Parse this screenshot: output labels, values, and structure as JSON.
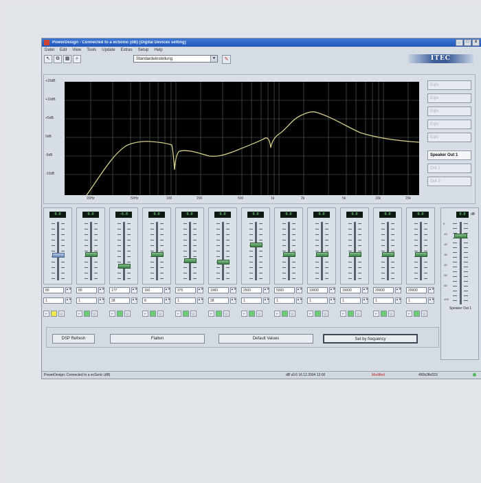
{
  "window": {
    "title": "PowerDesign - Connected to a ecSonic (dB) [Digital Devices setting]",
    "controls": [
      "_",
      "□",
      "x"
    ]
  },
  "menu": [
    "Datei",
    "Edit",
    "View",
    "Tools",
    "Update",
    "Extras",
    "Setup",
    "Help"
  ],
  "toolbar": {
    "buttons": [
      "arrow-icon",
      "copy-icon",
      "grid-icon",
      "zoom-icon"
    ],
    "preset_value": "Standardeinstellung",
    "logo": "ITEC"
  },
  "graph": {
    "y_labels": [
      "+15dB",
      "+10dB",
      "+5dB",
      "0dB",
      "-5dB",
      "-10dB"
    ],
    "x_labels": [
      "20Hz",
      "50Hz",
      "100",
      "200",
      "500",
      "1k",
      "2k",
      "5k",
      "10k",
      "20k"
    ],
    "side_buttons": [
      {
        "label": "Eqlo",
        "active": false
      },
      {
        "label": "Eqlo",
        "active": false
      },
      {
        "label": "Eqlo",
        "active": false
      },
      {
        "label": "Eqlo",
        "active": false
      },
      {
        "label": "Eqlo",
        "active": false
      },
      {
        "label": "Speaker Out 1",
        "active": true
      },
      {
        "label": "Out 2",
        "active": false
      },
      {
        "label": "Out 3",
        "active": false
      }
    ]
  },
  "strips": [
    {
      "readout": "0.0",
      "freq": "80",
      "gain": "1",
      "level": 0.42,
      "style": "blue",
      "bottom": "yellow"
    },
    {
      "readout": "0.0",
      "freq": "80",
      "gain": "1",
      "level": 0.44,
      "style": "green",
      "bottom": "green"
    },
    {
      "readout": "-6.0",
      "freq": "177",
      "gain": "28",
      "level": 0.22,
      "style": "green",
      "bottom": "green"
    },
    {
      "readout": "0.0",
      "freq": "160",
      "gain": "8",
      "level": 0.44,
      "style": "green",
      "bottom": "green"
    },
    {
      "readout": "0.0",
      "freq": "375",
      "gain": "1",
      "level": 0.32,
      "style": "green",
      "bottom": "green"
    },
    {
      "readout": "0.0",
      "freq": "1060",
      "gain": "28",
      "level": 0.3,
      "style": "green",
      "bottom": "green"
    },
    {
      "readout": "0.0",
      "freq": "2500",
      "gain": "1",
      "level": 0.62,
      "style": "green",
      "bottom": "green"
    },
    {
      "readout": "0.0",
      "freq": "5000",
      "gain": "1",
      "level": 0.44,
      "style": "green",
      "bottom": "green"
    },
    {
      "readout": "0.0",
      "freq": "10000",
      "gain": "1",
      "level": 0.44,
      "style": "green",
      "bottom": "green"
    },
    {
      "readout": "0.0",
      "freq": "15000",
      "gain": "1",
      "level": 0.44,
      "style": "green",
      "bottom": "green"
    },
    {
      "readout": "0.0",
      "freq": "20000",
      "gain": "1",
      "level": 0.44,
      "style": "green",
      "bottom": "green"
    },
    {
      "readout": "0.0",
      "freq": "20000",
      "gain": "1",
      "level": 0.44,
      "style": "green",
      "bottom": "green"
    }
  ],
  "master": {
    "readout": "0.0",
    "unit": "dB",
    "name": "Speaker Out 1",
    "ticks": [
      "0",
      "-10",
      "-20",
      "-30",
      "-40",
      "-50",
      "-60",
      "-100"
    ],
    "level": 0.85
  },
  "actions": {
    "dsp_refresh": "DSP Refresh",
    "flatten": "Flatten",
    "default_values": "Default Values",
    "set_by_frequency": "Set by frequency"
  },
  "status": {
    "connection": "PowerDesign: Connected to a ecSonic (dB)",
    "info": "dB   v0.6   16.12.2004 13:00",
    "modified": "Modified",
    "version": "450b2fb/023"
  }
}
